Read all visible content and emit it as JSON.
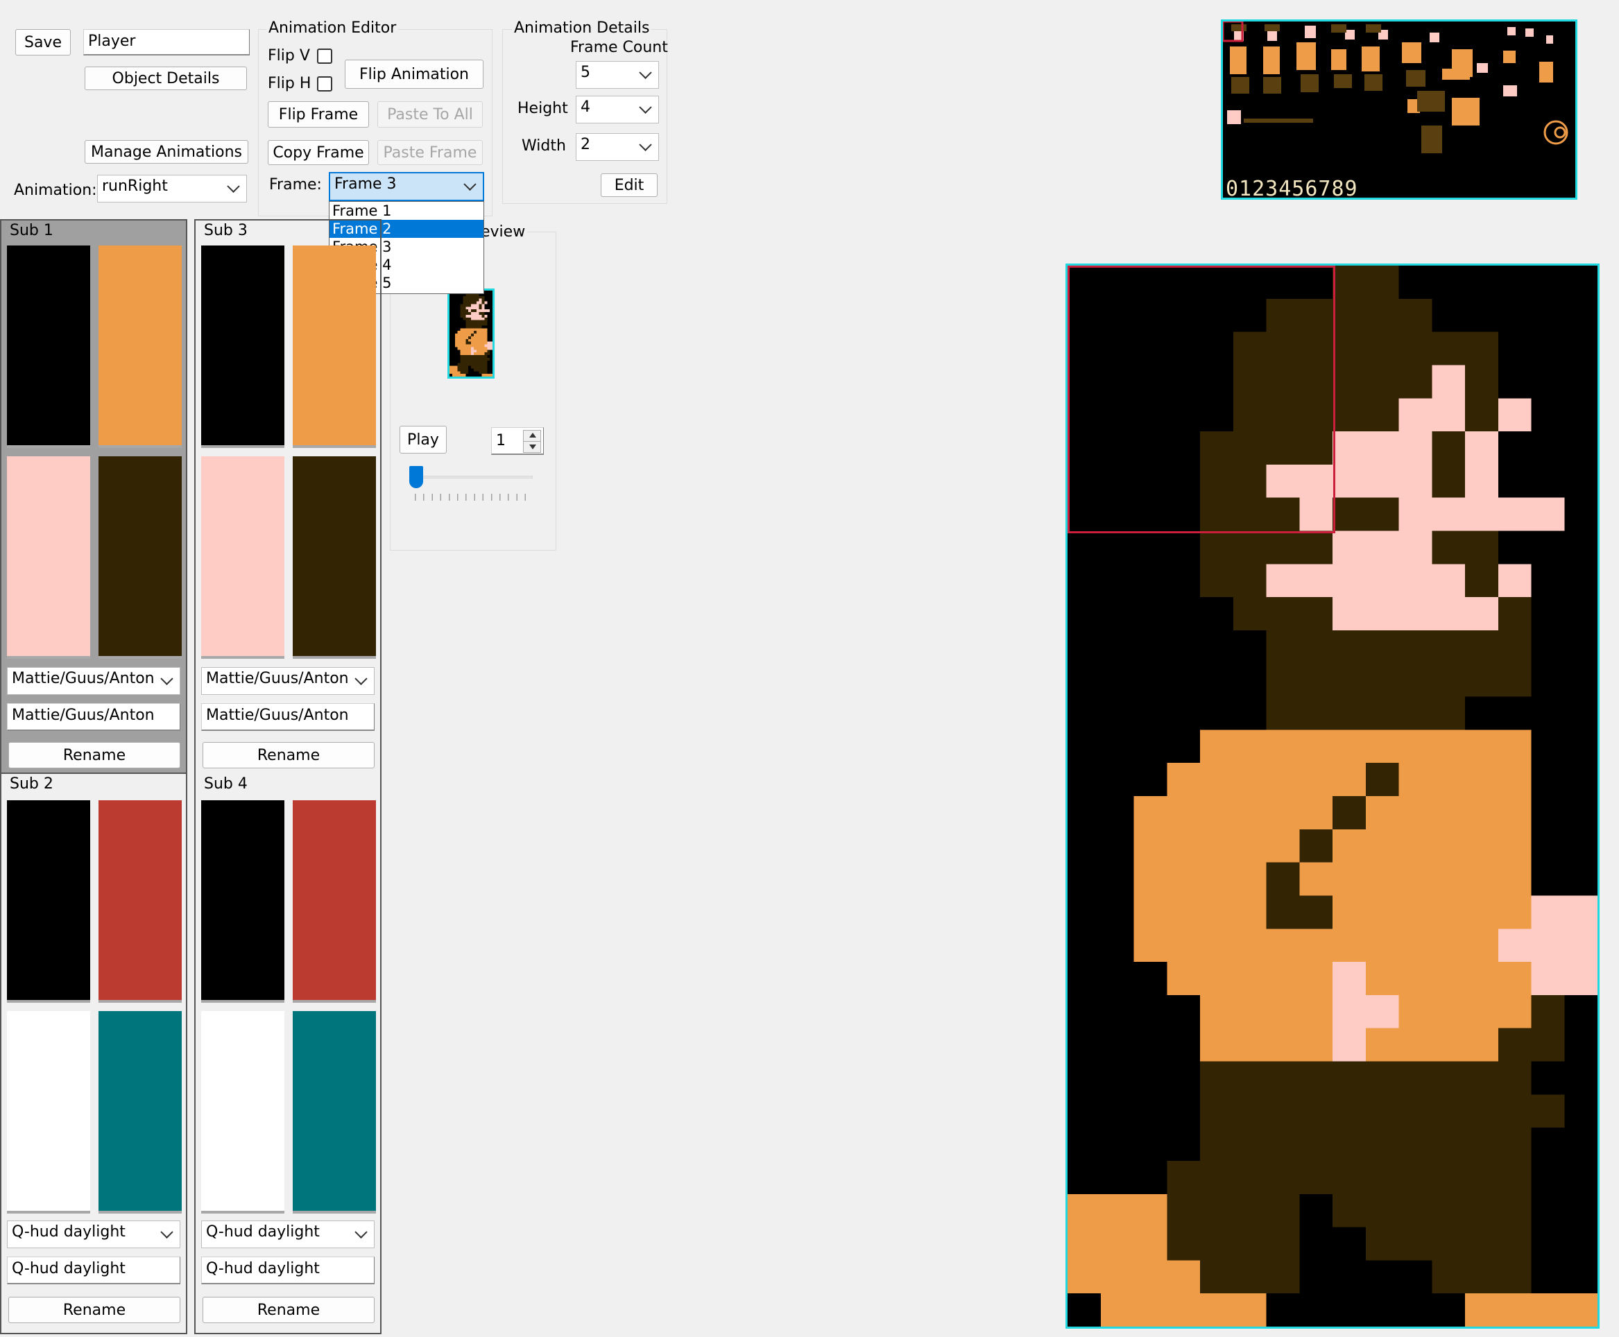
{
  "toolbar": {
    "save_label": "Save",
    "object_name": "Player",
    "object_details_label": "Object Details",
    "manage_animations_label": "Manage Animations",
    "animation_label": "Animation:",
    "animation_value": "runRight"
  },
  "animation_editor": {
    "title": "Animation Editor",
    "flip_v_label": "Flip V",
    "flip_h_label": "Flip H",
    "flip_animation_label": "Flip Animation",
    "flip_frame_label": "Flip Frame",
    "paste_to_all_label": "Paste To All",
    "copy_frame_label": "Copy Frame",
    "paste_frame_label": "Paste Frame",
    "frame_label": "Frame:",
    "frame_value": "Frame 3",
    "frame_options": [
      "Frame 1",
      "Frame 2",
      "Frame 3",
      "Frame 4",
      "Frame 5"
    ],
    "highlighted_option": "Frame 2"
  },
  "animation_details": {
    "title": "Animation Details",
    "frame_count_label": "Frame Count",
    "frame_count_value": "5",
    "height_label": "Height",
    "height_value": "4",
    "width_label": "Width",
    "width_value": "2",
    "edit_label": "Edit"
  },
  "preview": {
    "title_visible_part": "eview",
    "play_label": "Play",
    "speed_value": "1"
  },
  "subpalettes": [
    {
      "title": "Sub 1",
      "colors": [
        "#000000",
        "#ef9c48",
        "#ffccc5",
        "#332503"
      ],
      "palette_select": "Mattie/Guus/Anton",
      "name_value": "Mattie/Guus/Anton",
      "rename_label": "Rename",
      "selected": true
    },
    {
      "title": "Sub 2",
      "colors": [
        "#000000",
        "#bb3b31",
        "#ffffff",
        "#00757c"
      ],
      "palette_select": "Q-hud daylight",
      "name_value": "Q-hud daylight",
      "rename_label": "Rename",
      "selected": false
    },
    {
      "title": "Sub 3",
      "colors": [
        "#000000",
        "#ef9c48",
        "#ffccc5",
        "#332503"
      ],
      "palette_select": "Mattie/Guus/Anton",
      "name_value": "Mattie/Guus/Anton",
      "rename_label": "Rename",
      "selected": false
    },
    {
      "title": "Sub 4",
      "colors": [
        "#000000",
        "#bb3b31",
        "#ffffff",
        "#00757c"
      ],
      "palette_select": "Q-hud daylight",
      "name_value": "Q-hud daylight",
      "rename_label": "Rename",
      "selected": false
    }
  ],
  "tileset": {
    "digits_text": "0123456789"
  },
  "colors": {
    "highlight_cyan": "#20d8e0",
    "tile_selection_red": "#cc1f3c",
    "dropdown_selection": "#0078d7"
  }
}
